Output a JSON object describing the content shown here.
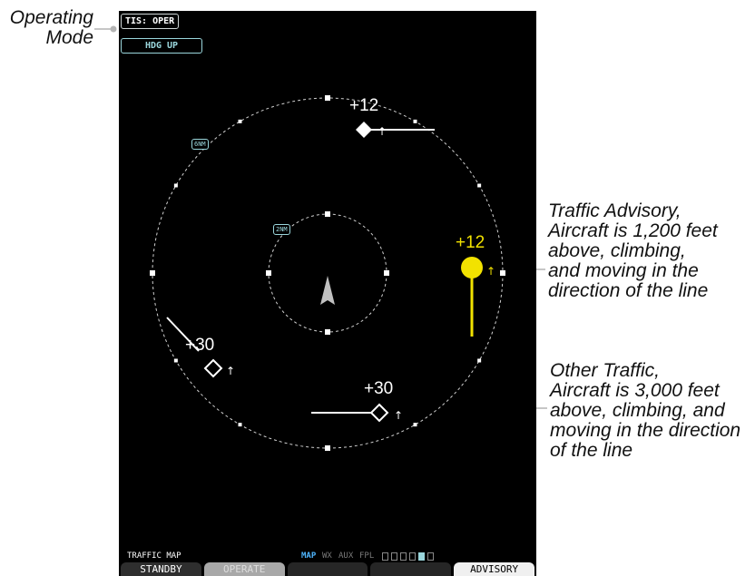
{
  "callouts": {
    "operating_mode": [
      "Operating",
      "Mode"
    ],
    "traffic_advisory": [
      "Traffic Advisory,",
      "Aircraft is 1,200 feet",
      "above, climbing,",
      "and moving in the",
      "direction of the line"
    ],
    "other_traffic": [
      "Other Traffic,",
      "Aircraft is 3,000 feet",
      "above, climbing, and",
      "moving in the direction",
      "of the line"
    ]
  },
  "display": {
    "mode_label": "TIS: OPER",
    "orientation_label": "HDG UP",
    "outer_range": "6NM",
    "inner_range": "2NM"
  },
  "traffic": {
    "top_other_alt": "+12",
    "advisory_alt": "+12",
    "left_other_alt": "+30",
    "bottom_other_alt": "+30",
    "climb_arrow": "↑"
  },
  "status": {
    "page_title": "TRAFFIC MAP",
    "page_groups": [
      "MAP",
      "WX",
      "AUX",
      "FPL"
    ]
  },
  "softkeys": [
    "STANDBY",
    "OPERATE",
    "",
    "",
    "ADVISORY"
  ],
  "colors": {
    "advisory": "#f2e200",
    "other_traffic": "#ffffff",
    "range_ring": "#d0d0d0",
    "cyan": "#9ad6dc",
    "own_ship": "#c0c0c0"
  }
}
